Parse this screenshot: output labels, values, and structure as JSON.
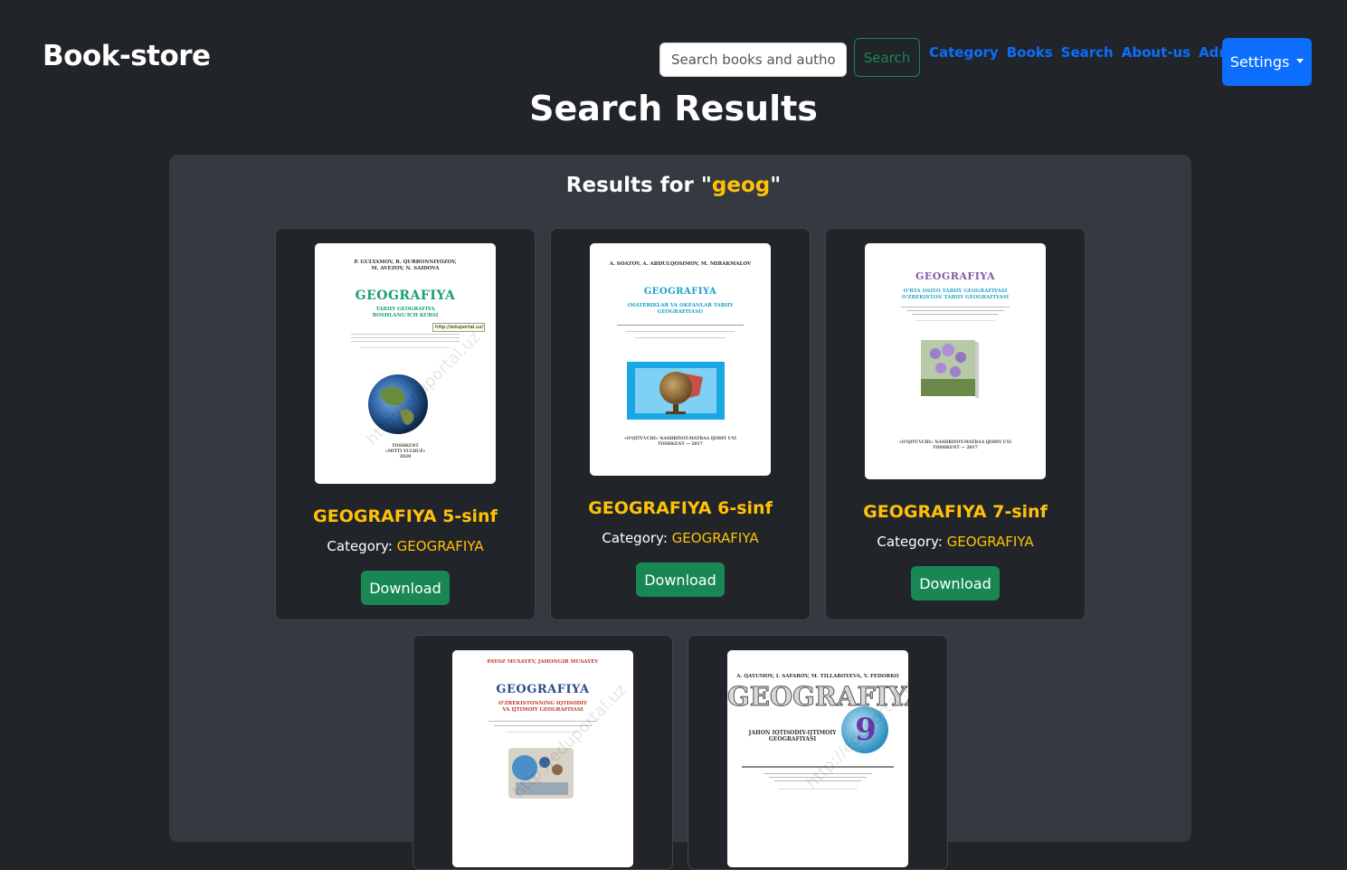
{
  "navbar": {
    "brand": "Book-store",
    "search_placeholder": "Search books and authors",
    "search_button": "Search",
    "links": [
      "Category",
      "Books",
      "Search",
      "About-us",
      "Admin"
    ],
    "settings_label": "Settings"
  },
  "page": {
    "title": "Search Results",
    "results_prefix": "Results for \"",
    "query": "geog",
    "results_suffix": "\""
  },
  "books": [
    {
      "title": "GEOGRAFIYA 5-sinf",
      "category_label": "Category:",
      "category": "GEOGRAFIYA",
      "download_label": "Download",
      "cover": {
        "authors": "P. GULYAMOV,   R. QURBONNIYOZOV,\nM. AVEZOV,  N. SAIDOVA",
        "title": "GEOGRAFIYA",
        "subtitle": "TABIIY GEOGRAFIYA\nBOSHLANG'ICH KURSI",
        "tooltip": "http://eduportal.uz/",
        "footer": "TOSHKENT\n«MITTI YULDUZ»\n2020",
        "watermark": "http://eduportal.uz"
      }
    },
    {
      "title": "GEOGRAFIYA 6-sinf",
      "category_label": "Category:",
      "category": "GEOGRAFIYA",
      "download_label": "Download",
      "cover": {
        "authors": "A. SOATOV,  A. ABDULQOSIMOV,   M. MIRAKMALOV",
        "title": "GEOGRAFIYA",
        "subtitle": "(MATERIKLAR VA OKEANLAR TABIIY\nGEOGRAFIYASI)",
        "footer": "«O'QITUVCHI» NASHRIYOT-MATBAA IJODIY UYI\nTOSHKENT — 2017"
      }
    },
    {
      "title": "GEOGRAFIYA 7-sinf",
      "category_label": "Category:",
      "category": "GEOGRAFIYA",
      "download_label": "Download",
      "cover": {
        "title": "GEOGRAFIYA",
        "subtitle": "O'RTA OSIYO TABIIY GEOGRAFIYASI\nO'ZBEKISTON TABIIY GEOGRAFIYASI",
        "footer": "«O'QITUVCHI» NASHRIYOT-MATBAA IJODIY UYI\nTOSHKENT — 2017"
      }
    },
    {
      "title": "",
      "category_label": "",
      "category": "",
      "download_label": "",
      "cover": {
        "authors": "PAYOZ MUSAYEV, JAHONGIR MUSAYEV",
        "title": "GEOGRAFIYA",
        "subtitle": "O'ZBEKISTONNING IQTISODIY\nVA IJTIMOIY GEOGRAFIYASI",
        "watermark": "http://eduportal.uz"
      }
    },
    {
      "title": "",
      "category_label": "",
      "category": "",
      "download_label": "",
      "cover": {
        "authors": "A. QAYUMOV, I. SAFAROV, M. TILLABOYEVA, V. FEDORKO",
        "title": "GEOGRAFIYA",
        "grade": "9",
        "subtitle": "JAHON IQTISODIY-IJTIMOIY\nGEOGRAFIYASI",
        "watermark": "http://eduportal.uz"
      }
    }
  ],
  "colors": {
    "accent": "#ffc107",
    "primary": "#0d6efd",
    "success": "#198754",
    "background": "#212529",
    "panel": "#343a40"
  }
}
